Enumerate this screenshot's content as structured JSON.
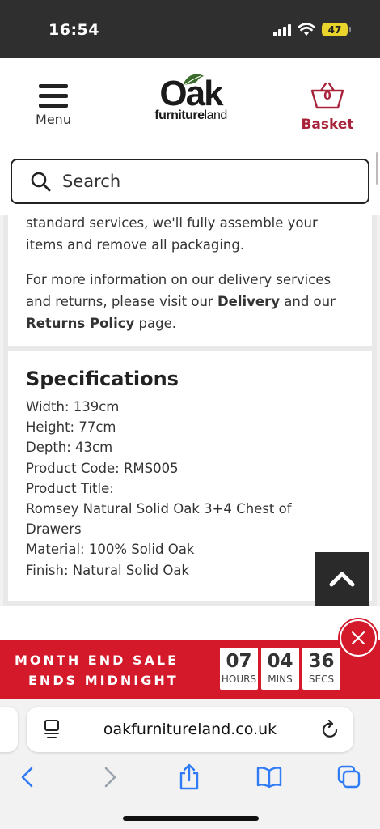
{
  "status_bar": {
    "time": "16:54",
    "battery": "47",
    "icons": [
      "signal-icon",
      "wifi-icon",
      "battery-icon"
    ]
  },
  "header": {
    "menu_label": "Menu",
    "logo_main": "Oak",
    "logo_sub_bold": "furniture",
    "logo_sub_rest": "land",
    "basket_count": "0",
    "basket_label": "Basket"
  },
  "search": {
    "placeholder": "Search"
  },
  "delivery": {
    "partial_line": "standard services, we'll fully assemble your",
    "line2": "items and remove all packaging.",
    "para2_pre": "For more information on our delivery services and returns, please visit our ",
    "delivery_link": "Delivery",
    "para2_mid": " and our ",
    "returns_link": "Returns Policy",
    "para2_post": " page."
  },
  "specifications": {
    "title": "Specifications",
    "width": "Width: 139cm",
    "height": "Height: 77cm",
    "depth": "Depth: 43cm",
    "product_code": "Product Code: RMS005",
    "product_title_label": "Product Title:",
    "product_title": "Romsey Natural Solid Oak 3+4 Chest of Drawers",
    "material": "Material: 100% Solid Oak",
    "finish": "Finish: Natural Solid Oak"
  },
  "sale_banner": {
    "line1": "MONTH END SALE",
    "line2": "ENDS MIDNIGHT",
    "countdown": [
      {
        "value": "07",
        "unit": "HOURS"
      },
      {
        "value": "04",
        "unit": "MINS"
      },
      {
        "value": "36",
        "unit": "SECS"
      }
    ],
    "color": "#d3192a"
  },
  "browser": {
    "url": "oakfurnitureland.co.uk"
  },
  "colors": {
    "brand": "#a8233a",
    "sale_red": "#d3192a",
    "ios_blue": "#2f7cf6"
  }
}
